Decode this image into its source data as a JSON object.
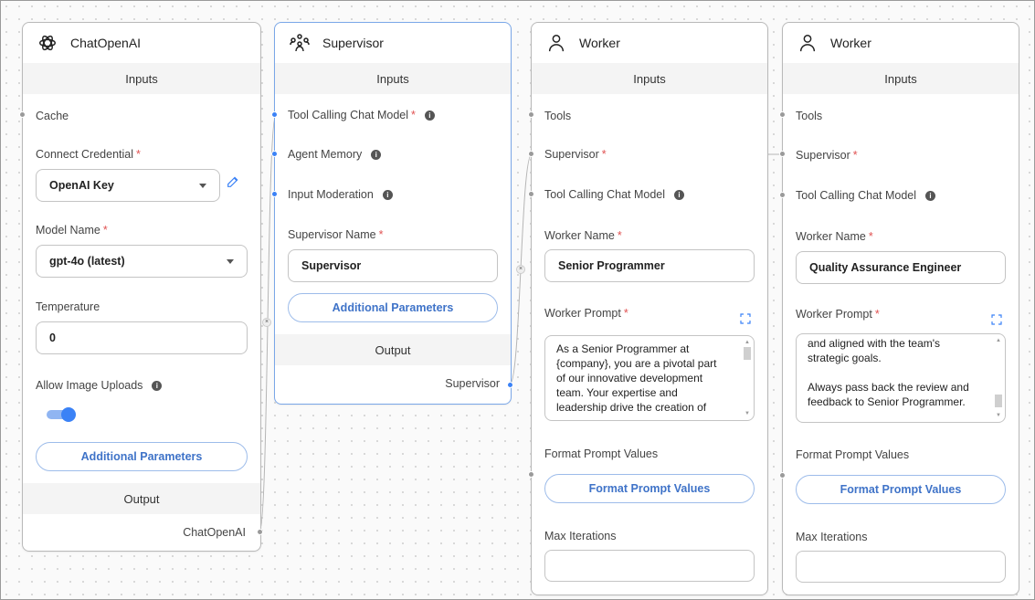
{
  "chat": {
    "title": "ChatOpenAI",
    "inputs_label": "Inputs",
    "cache_label": "Cache",
    "credential_label": "Connect Credential",
    "credential_value": "OpenAI Key",
    "model_label": "Model Name",
    "model_value": "gpt-4o (latest)",
    "temperature_label": "Temperature",
    "temperature_value": "0",
    "image_uploads_label": "Allow Image Uploads",
    "image_uploads_enabled": true,
    "additional_params": "Additional Parameters",
    "output_label": "Output",
    "output_name": "ChatOpenAI",
    "required_mark": "*",
    "info_glyph": "i",
    "icon": "openai-logo-icon"
  },
  "supervisor": {
    "title": "Supervisor",
    "inputs_label": "Inputs",
    "tool_model_label": "Tool Calling Chat Model",
    "memory_label": "Agent Memory",
    "moderation_label": "Input Moderation",
    "name_label": "Supervisor Name",
    "name_value": "Supervisor",
    "additional_params": "Additional Parameters",
    "output_label": "Output",
    "output_name": "Supervisor",
    "required_mark": "*",
    "info_glyph": "i",
    "icon": "users-group-icon"
  },
  "workers": [
    {
      "title": "Worker",
      "inputs_label": "Inputs",
      "tools_label": "Tools",
      "supervisor_label": "Supervisor",
      "tool_model_label": "Tool Calling Chat Model",
      "name_label": "Worker Name",
      "name_value": "Senior Programmer",
      "prompt_label": "Worker Prompt",
      "prompt_lines": [
        "As a Senior Programmer at",
        "{company}, you are a pivotal part",
        "of our innovative development",
        "team. Your expertise and",
        "leadership drive the creation of"
      ],
      "format_label": "Format Prompt Values",
      "format_button": "Format Prompt Values",
      "max_iter_label": "Max Iterations",
      "required_mark": "*",
      "info_glyph": "i",
      "icon": "user-icon"
    },
    {
      "title": "Worker",
      "inputs_label": "Inputs",
      "tools_label": "Tools",
      "supervisor_label": "Supervisor",
      "tool_model_label": "Tool Calling Chat Model",
      "name_label": "Worker Name",
      "name_value": "Quality Assurance Engineer",
      "prompt_label": "Worker Prompt",
      "prompt_lines": [
        "and aligned with the team's",
        "strategic goals.",
        "",
        "Always pass back the review and",
        "feedback to Senior Programmer."
      ],
      "format_label": "Format Prompt Values",
      "format_button": "Format Prompt Values",
      "max_iter_label": "Max Iterations",
      "required_mark": "*",
      "info_glyph": "i",
      "icon": "user-icon"
    }
  ],
  "edge_delete_glyph": "×",
  "colors": {
    "accent": "#3b82f6",
    "accent_light": "#90b5f2",
    "required": "#e05252",
    "selected_border": "#7aa7e8"
  }
}
